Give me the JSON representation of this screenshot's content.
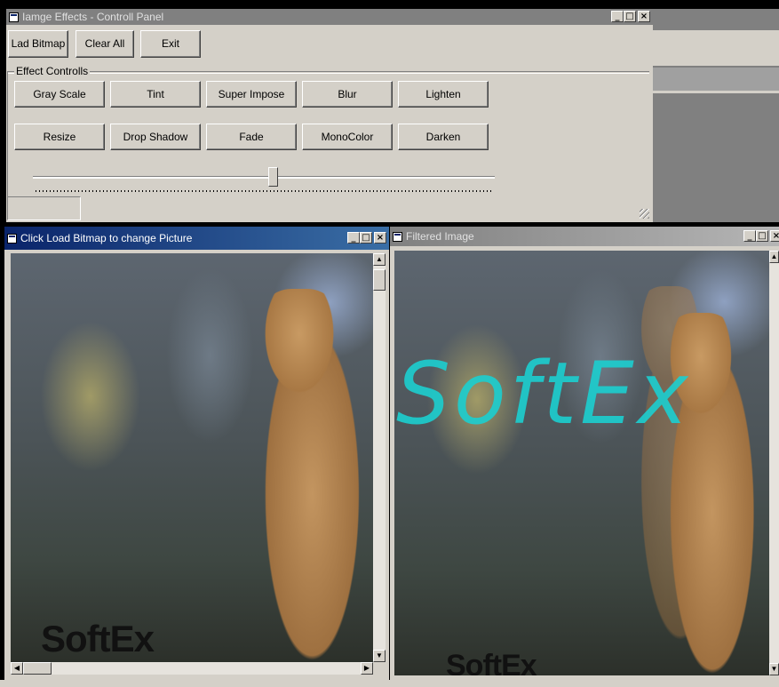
{
  "control_panel": {
    "title": "Iamge Effects - Controll Panel",
    "buttons": {
      "load": "Lad Bitmap",
      "clear": "Clear All",
      "exit": "Exit"
    },
    "group_label": "Effect Controlls",
    "effects": [
      "Gray Scale",
      "Tint",
      "Super Impose",
      "Blur",
      "Lighten",
      "Resize",
      "Drop Shadow",
      "Fade",
      "MonoColor",
      "Darken"
    ],
    "slider_value_percent": 52
  },
  "source_window": {
    "title": "Click Load Bitmap to change Picture",
    "watermark": "SoftEx"
  },
  "filtered_window": {
    "title": "Filtered Image",
    "overlay_text": "SoftEx",
    "watermark": "SoftEx"
  },
  "window_buttons": {
    "minimize": "_",
    "maximize": "□",
    "close": "×"
  },
  "colors": {
    "active_title": "#0a246a",
    "inactive_title": "#808080",
    "face": "#d4d0c8",
    "overlay_text": "#1ccfd0"
  }
}
